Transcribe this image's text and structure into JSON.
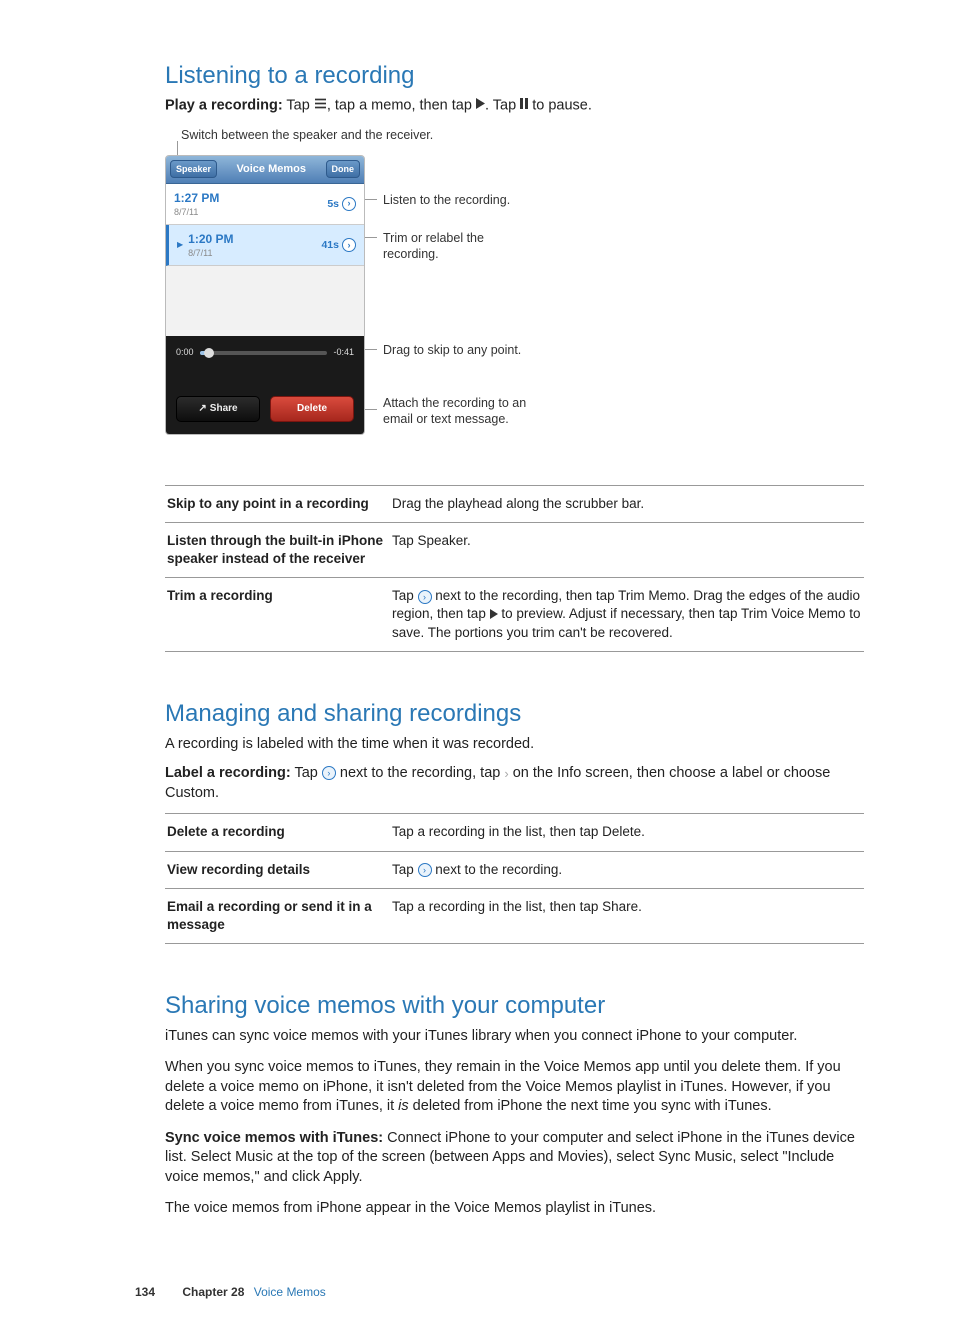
{
  "sections": {
    "listening": {
      "title": "Listening to a recording",
      "instruction_label": "Play a recording:",
      "instruction_text_1": " Tap ",
      "instruction_text_2": ", tap a memo, then tap ",
      "instruction_text_3": ". Tap ",
      "instruction_text_4": " to pause."
    },
    "managing": {
      "title": "Managing and sharing recordings",
      "intro": "A recording is labeled with the time when it was recorded.",
      "label_instruction_label": "Label a recording:",
      "label_instruction_1": " Tap ",
      "label_instruction_2": " next to the recording, tap ",
      "label_instruction_3": " on the Info screen, then choose a label or choose Custom."
    },
    "sharing": {
      "title": "Sharing voice memos with your computer",
      "p1": "iTunes can sync voice memos with your iTunes library when you connect iPhone to your computer.",
      "p2a": "When you sync voice memos to iTunes, they remain in the Voice Memos app until you delete them. If you delete a voice memo on iPhone, it isn't deleted from the Voice Memos playlist in iTunes. However, if you delete a voice memo from iTunes, it ",
      "p2b_italic": "is",
      "p2c": " deleted from iPhone the next time you sync with iTunes.",
      "sync_label": "Sync voice memos with iTunes:",
      "sync_text": " Connect iPhone to your computer and select iPhone in the iTunes device list. Select Music at the top of the screen (between Apps and Movies), select Sync Music, select \"Include voice memos,\" and click Apply.",
      "p3": "The voice memos from iPhone appear in the Voice Memos playlist in iTunes."
    }
  },
  "screenshot": {
    "header_note": "Switch between the speaker and the receiver.",
    "nav": {
      "left": "Speaker",
      "title": "Voice Memos",
      "right": "Done"
    },
    "row1": {
      "time": "1:27 PM",
      "date": "8/7/11",
      "dur": "5s"
    },
    "row2": {
      "time": "1:20 PM",
      "date": "8/7/11",
      "dur": "41s"
    },
    "scrub": {
      "left": "0:00",
      "right": "-0:41"
    },
    "buttons": {
      "share": "Share",
      "delete": "Delete"
    },
    "annotations": {
      "listen": "Listen to the recording.",
      "trim": "Trim or relabel the recording.",
      "drag": "Drag to skip to any point.",
      "attach": "Attach the recording to an email or text message."
    }
  },
  "table1": [
    {
      "left": "Skip to any point in a recording",
      "right": "Drag the playhead along the scrubber bar."
    },
    {
      "left": "Listen through the built-in iPhone speaker instead of the receiver",
      "right": "Tap Speaker."
    },
    {
      "left": "Trim a recording",
      "right_pre": "Tap ",
      "right_mid": " next to the recording, then tap Trim Memo. Drag the edges of the audio region, then tap ",
      "right_post": " to preview. Adjust if necessary, then tap Trim Voice Memo to save. The portions you trim can't be recovered."
    }
  ],
  "table2": [
    {
      "left": "Delete a recording",
      "right": "Tap a recording in the list, then tap Delete."
    },
    {
      "left": "View recording details",
      "right_pre": "Tap ",
      "right_post": " next to the recording."
    },
    {
      "left": "Email a recording or send it in a message",
      "right": "Tap a recording in the list, then tap Share."
    }
  ],
  "footer": {
    "page": "134",
    "chapter_label": "Chapter 28",
    "chapter_name": "Voice Memos"
  }
}
